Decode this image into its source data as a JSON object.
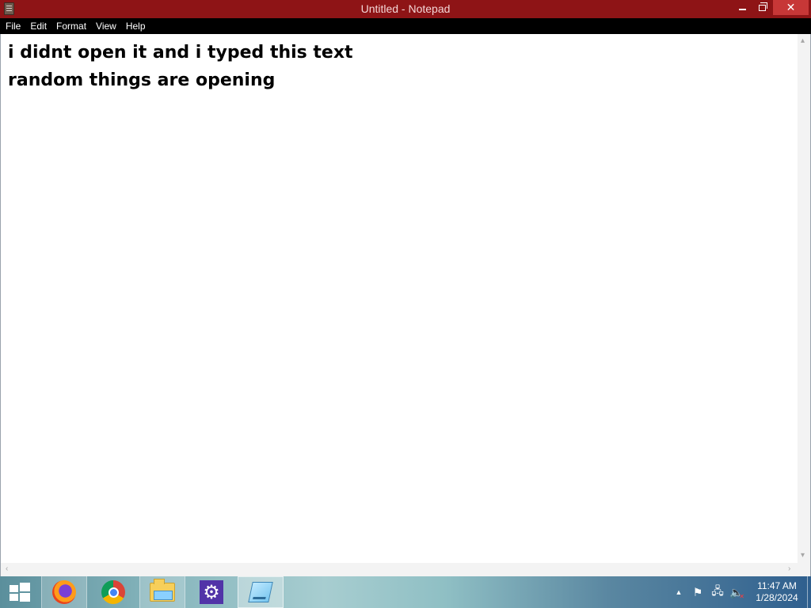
{
  "window": {
    "title": "Untitled - Notepad",
    "close_glyph": "✕",
    "accent_color": "#8e1416",
    "close_color": "#c73737"
  },
  "menu": {
    "items": [
      "File",
      "Edit",
      "Format",
      "View",
      "Help"
    ]
  },
  "editor": {
    "content": "i didnt open it and i typed this text\nrandom things are opening"
  },
  "taskbar": {
    "apps": [
      {
        "name": "firefox-icon"
      },
      {
        "name": "chrome-icon"
      },
      {
        "name": "file-explorer-icon"
      },
      {
        "name": "settings-gear-icon",
        "glyph": "⚙"
      },
      {
        "name": "notepad-icon"
      }
    ],
    "tray": {
      "expand_glyph": "▲",
      "flag_glyph": "⚑",
      "network_glyph": "🖧",
      "volume_glyph": "🔈",
      "muted_glyph": "✕"
    },
    "clock": {
      "time": "11:47 AM",
      "date": "1/28/2024"
    }
  }
}
